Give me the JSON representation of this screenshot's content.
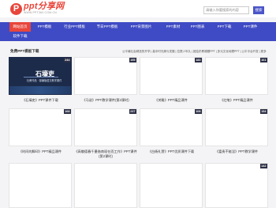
{
  "header": {
    "logo_mark": "P",
    "logo_name": "ppt分享网",
    "logo_domain": "WWW.PPT360.COM.CN",
    "search_placeholder": "请输入你要搜索的内容",
    "search_button": "搜索"
  },
  "nav": {
    "items": [
      {
        "label": "网站首页",
        "active": true
      },
      {
        "label": "PPT模板",
        "active": false
      },
      {
        "label": "行业PPT模板",
        "active": false
      },
      {
        "label": "节日PPT模板",
        "active": false
      },
      {
        "label": "PPT背景图片",
        "active": false
      },
      {
        "label": "PPT素材",
        "active": false
      },
      {
        "label": "PPT图表",
        "active": false
      },
      {
        "label": "PPT下载",
        "active": false
      },
      {
        "label": "PPT课件",
        "active": false
      },
      {
        "label": "软件下载",
        "active": false
      }
    ]
  },
  "section": {
    "title": "免费PPT模板下载",
    "links": "公平最社会精选的开学 | 高中时光美与发展 | 拉提少年久 | 团结史教课题PPT | 多元文化地理PPT | 公平平台开发 | 更多"
  },
  "cards": [
    {
      "count": "244",
      "caption": "《石壕吏》PPT课件下载",
      "thumb_title": "石壕吏",
      "thumb_sub": "杜甫作品 · 部编版语文教学课件"
    },
    {
      "count": "155",
      "caption": "《马说》PPT教学课件(第2课时)"
    },
    {
      "count": "183",
      "caption": "《关雎》PPT精品课件"
    },
    {
      "count": "161",
      "caption": "《红笔》PPT精品课件"
    },
    {
      "count": "168",
      "caption": "《时间的脚印》PPT精品课件"
    },
    {
      "count": "237",
      "caption": "《高敬德春千墨借南现在而工作》PPT课件(第2课时)"
    },
    {
      "count": "108",
      "caption": "《白杨礼赞》PPT优质课件下载"
    },
    {
      "count": "154",
      "caption": "《富贵不能淫》PPT教学课件"
    },
    {
      "count": "",
      "caption": ""
    },
    {
      "count": "",
      "caption": ""
    },
    {
      "count": "",
      "caption": ""
    },
    {
      "count": "142",
      "caption": ""
    }
  ],
  "colors": {
    "nav_bg": "#3f4bc4",
    "nav_active": "#e8463b",
    "brand": "#e8463b",
    "search_button": "#4a54c8"
  }
}
